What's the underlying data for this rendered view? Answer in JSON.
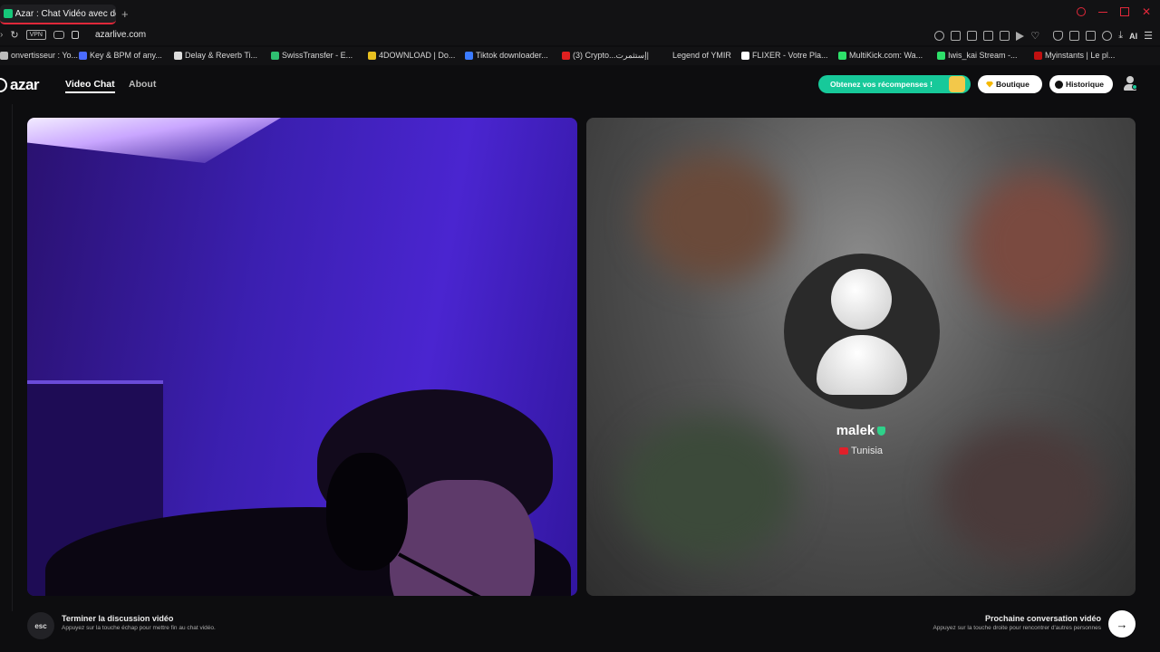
{
  "browser": {
    "tab_title": "Azar : Chat Vidéo avec de",
    "new_tab": "+",
    "url": "azarlive.com",
    "vpn_label": "VPN",
    "ai_label": "AI"
  },
  "bookmarks": [
    {
      "label": "onvertisseur : Yo...",
      "color": "#bbbbbb"
    },
    {
      "label": "Key & BPM of any...",
      "color": "#4a6bff"
    },
    {
      "label": "Delay & Reverb Ti...",
      "color": "#dddddd"
    },
    {
      "label": "SwissTransfer - E...",
      "color": "#2fbf71"
    },
    {
      "label": "4DOWNLOAD | Do...",
      "color": "#e8c020"
    },
    {
      "label": "Tiktok downloader...",
      "color": "#3b7bff"
    },
    {
      "label": "(3) Crypto...إستثمرت|",
      "color": "#e02020"
    },
    {
      "label": "Legend of YMIR",
      "color": "#121214"
    },
    {
      "label": "FLIXER - Votre Pla...",
      "color": "#ffffff"
    },
    {
      "label": "MultiKick.com: Wa...",
      "color": "#2ee06a"
    },
    {
      "label": "Iwis_kai Stream -...",
      "color": "#2ee06a"
    },
    {
      "label": "Myinstants | Le pl...",
      "color": "#c01010"
    }
  ],
  "appbar": {
    "logo": "azar",
    "nav_video_chat": "Video Chat",
    "nav_about": "About",
    "rewards_label": "Obtenez vos récompenses !",
    "boutique_label": "Boutique",
    "historique_label": "Historique"
  },
  "peer": {
    "name": "malek",
    "country": "Tunisia"
  },
  "footer": {
    "esc_key": "esc",
    "end_title": "Terminer la discussion vidéo",
    "end_sub": "Appuyez sur la touche échap pour mettre fin au chat vidéo.",
    "next_title": "Prochaine conversation vidéo",
    "next_sub": "Appuyez sur la touche droite pour rencontrer d'autres personnes",
    "next_arrow": "→"
  },
  "colors": {
    "accent_green": "#17c99a",
    "tab_accent": "#e0283a"
  }
}
